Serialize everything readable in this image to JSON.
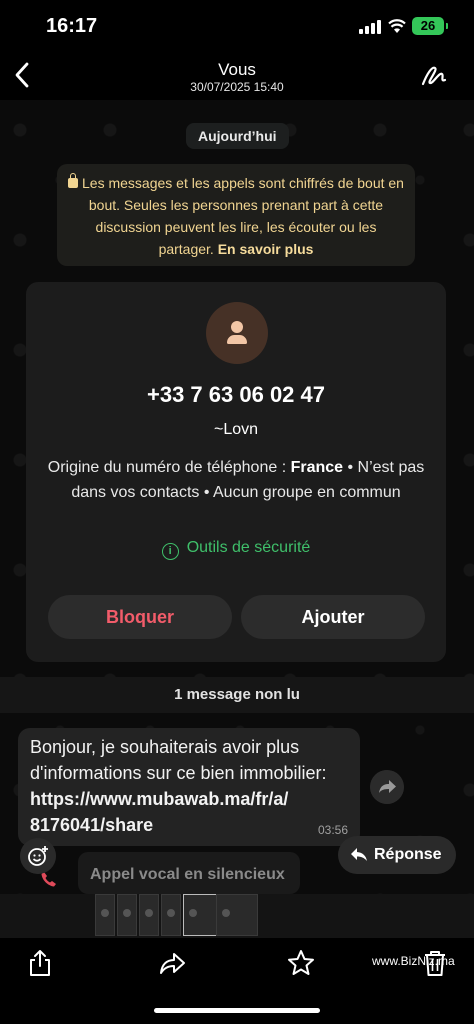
{
  "status": {
    "time": "16:17",
    "battery": "26"
  },
  "header": {
    "title": "Vous",
    "subtitle": "30/07/2025 15:40"
  },
  "chat": {
    "date_chip": "Aujourd’hui",
    "encryption_notice": "Les messages et les appels sont chiffrés de bout en bout. Seules les personnes prenant part à cette discussion peuvent les lire, les écouter ou les partager.",
    "encryption_link": "En savoir plus",
    "contact": {
      "phone": "+33 7 63 06 02 47",
      "pushname": "~Lovn",
      "origin_prefix": "Origine du numéro de téléphone : ",
      "origin_country": "France",
      "origin_suffix": " • N’est pas dans vos contacts • Aucun groupe en commun",
      "security_label": "Outils de sécurité",
      "block_label": "Bloquer",
      "add_label": "Ajouter"
    },
    "unread_label": "1 message non lu",
    "message": {
      "text": "Bonjour, je souhaiterais avoir plus d'informations sur ce bien immobilier:",
      "url_line1": "https://www.mubawab.ma/fr/a/",
      "url_line2": "8176041/share",
      "time": "03:56"
    },
    "call_label": "Appel vocal en silencieux",
    "reply_label": "Réponse"
  },
  "footer": {
    "watermark": "www.BizNiz.ma"
  },
  "colors": {
    "accent_green": "#3fbf6a",
    "danger_red": "#f25c6a",
    "notice_yellow": "#f1d592"
  }
}
